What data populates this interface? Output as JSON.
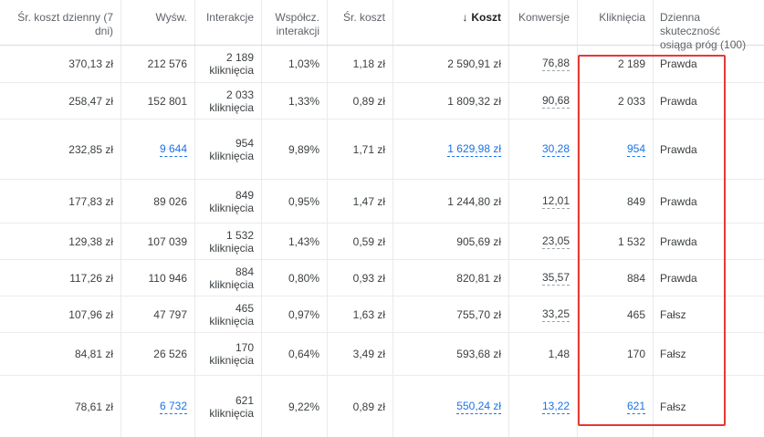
{
  "headers": {
    "avg_daily_cost": "Śr. koszt dzienny (7 dni)",
    "impressions": "Wyśw.",
    "interactions": "Interakcje",
    "interaction_rate_line1": "Współcz.",
    "interaction_rate_line2": "interakcji",
    "avg_cost": "Śr. koszt",
    "cost_icon": "↓",
    "cost": "Koszt",
    "conversions": "Konwersje",
    "clicks": "Kliknięcia",
    "daily_efficiency_line1": "Dzienna skuteczność",
    "daily_efficiency_line2": "osiąga próg (100)"
  },
  "sort": {
    "column": "cost",
    "direction": "descending",
    "icon": "arrow-down-icon"
  },
  "highlight_color": "#e53935",
  "link_color": "#1a73e8",
  "rows": [
    {
      "avg_daily_cost": "370,13 zł",
      "impressions": "212 576",
      "interactions": "2 189",
      "interactions_unit": "kliknięcia",
      "interaction_rate": "1,03%",
      "avg_cost": "1,18 zł",
      "cost": "2 590,91 zł",
      "conversions": "76,88",
      "clicks": "2 189",
      "efficiency": "Prawda"
    },
    {
      "avg_daily_cost": "258,47 zł",
      "impressions": "152 801",
      "interactions": "2 033",
      "interactions_unit": "kliknięcia",
      "interaction_rate": "1,33%",
      "avg_cost": "0,89 zł",
      "cost": "1 809,32 zł",
      "conversions": "90,68",
      "clicks": "2 033",
      "efficiency": "Prawda"
    },
    {
      "avg_daily_cost": "232,85 zł",
      "impressions": "9 644",
      "interactions": "954",
      "interactions_unit": "kliknięcia",
      "interaction_rate": "9,89%",
      "avg_cost": "1,71 zł",
      "cost": "1 629,98 zł",
      "conversions": "30,28",
      "clicks": "954",
      "efficiency": "Prawda"
    },
    {
      "avg_daily_cost": "177,83 zł",
      "impressions": "89 026",
      "interactions": "849",
      "interactions_unit": "kliknięcia",
      "interaction_rate": "0,95%",
      "avg_cost": "1,47 zł",
      "cost": "1 244,80 zł",
      "conversions": "12,01",
      "clicks": "849",
      "efficiency": "Prawda"
    },
    {
      "avg_daily_cost": "129,38 zł",
      "impressions": "107 039",
      "interactions": "1 532",
      "interactions_unit": "kliknięcia",
      "interaction_rate": "1,43%",
      "avg_cost": "0,59 zł",
      "cost": "905,69 zł",
      "conversions": "23,05",
      "clicks": "1 532",
      "efficiency": "Prawda"
    },
    {
      "avg_daily_cost": "117,26 zł",
      "impressions": "110 946",
      "interactions": "884",
      "interactions_unit": "kliknięcia",
      "interaction_rate": "0,80%",
      "avg_cost": "0,93 zł",
      "cost": "820,81 zł",
      "conversions": "35,57",
      "clicks": "884",
      "efficiency": "Prawda"
    },
    {
      "avg_daily_cost": "107,96 zł",
      "impressions": "47 797",
      "interactions": "465",
      "interactions_unit": "kliknięcia",
      "interaction_rate": "0,97%",
      "avg_cost": "1,63 zł",
      "cost": "755,70 zł",
      "conversions": "33,25",
      "clicks": "465",
      "efficiency": "Fałsz"
    },
    {
      "avg_daily_cost": "84,81 zł",
      "impressions": "26 526",
      "interactions": "170",
      "interactions_unit": "kliknięcia",
      "interaction_rate": "0,64%",
      "avg_cost": "3,49 zł",
      "cost": "593,68 zł",
      "conversions": "1,48",
      "clicks": "170",
      "efficiency": "Fałsz"
    },
    {
      "avg_daily_cost": "78,61 zł",
      "impressions": "6 732",
      "interactions": "621",
      "interactions_unit": "kliknięcia",
      "interaction_rate": "9,22%",
      "avg_cost": "0,89 zł",
      "cost": "550,24 zł",
      "conversions": "13,22",
      "clicks": "621",
      "efficiency": "Fałsz"
    }
  ]
}
